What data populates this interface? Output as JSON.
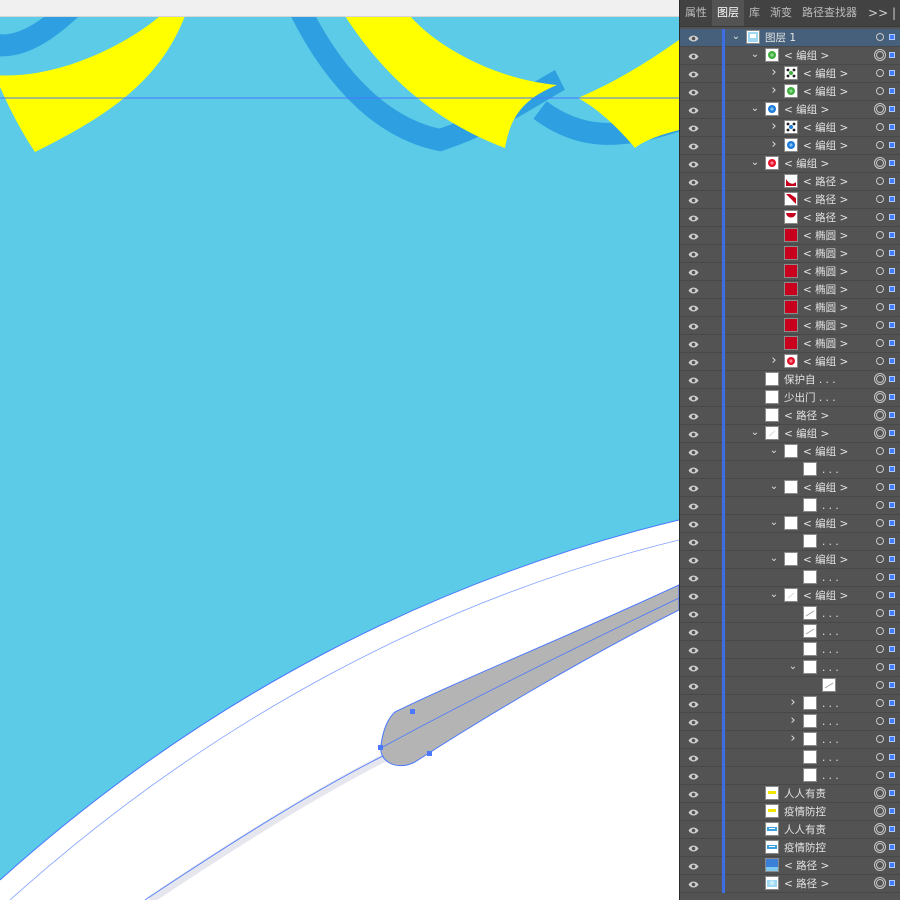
{
  "tabs": [
    {
      "label": "属性"
    },
    {
      "label": "图层"
    },
    {
      "label": "库"
    },
    {
      "label": "渐变"
    },
    {
      "label": "路径查找器"
    }
  ],
  "active_tab": "图层",
  "more_label": ">> |",
  "colors": {
    "canvas_bg": "#5BCBE8",
    "yellow": "#FFFF00",
    "arc_blue": "#2E9FE0",
    "guide_blue": "#4A78FF",
    "grey_shape": "#B4B4B4",
    "panel_bg": "#535353",
    "selected_row": "#46607C",
    "layer_stripe": "#3E6EE6"
  },
  "layers": [
    {
      "label": "图层 1",
      "indent": 0,
      "chevron": "down",
      "thumb": "layer",
      "selected": true,
      "target": "single"
    },
    {
      "label": "< 编组 >",
      "indent": 1,
      "chevron": "down",
      "thumb": "green",
      "target": "double"
    },
    {
      "label": "< 编组 >",
      "indent": 2,
      "chevron": "right",
      "thumb": "green-dots",
      "target": "single"
    },
    {
      "label": "< 编组 >",
      "indent": 2,
      "chevron": "right",
      "thumb": "green",
      "target": "single"
    },
    {
      "label": "< 编组 >",
      "indent": 1,
      "chevron": "down",
      "thumb": "blue",
      "target": "double"
    },
    {
      "label": "< 编组 >",
      "indent": 2,
      "chevron": "right",
      "thumb": "blue-dots",
      "target": "single"
    },
    {
      "label": "< 编组 >",
      "indent": 2,
      "chevron": "right",
      "thumb": "blue",
      "target": "single"
    },
    {
      "label": "< 编组 >",
      "indent": 1,
      "chevron": "down",
      "thumb": "red",
      "target": "double"
    },
    {
      "label": "< 路径 >",
      "indent": 2,
      "chevron": "none",
      "thumb": "red-arc",
      "target": "single"
    },
    {
      "label": "< 路径 >",
      "indent": 2,
      "chevron": "none",
      "thumb": "red-diag",
      "target": "single"
    },
    {
      "label": "< 路径 >",
      "indent": 2,
      "chevron": "none",
      "thumb": "red-bowl",
      "target": "single"
    },
    {
      "label": "< 椭圆 >",
      "indent": 2,
      "chevron": "none",
      "thumb": "red-circle",
      "target": "single"
    },
    {
      "label": "< 椭圆 >",
      "indent": 2,
      "chevron": "none",
      "thumb": "red-circle",
      "target": "single"
    },
    {
      "label": "< 椭圆 >",
      "indent": 2,
      "chevron": "none",
      "thumb": "red-circle",
      "target": "single"
    },
    {
      "label": "< 椭圆 >",
      "indent": 2,
      "chevron": "none",
      "thumb": "red-circle",
      "target": "single"
    },
    {
      "label": "< 椭圆 >",
      "indent": 2,
      "chevron": "none",
      "thumb": "red-circle",
      "target": "single"
    },
    {
      "label": "< 椭圆 >",
      "indent": 2,
      "chevron": "none",
      "thumb": "red-circle",
      "target": "single"
    },
    {
      "label": "< 椭圆 >",
      "indent": 2,
      "chevron": "none",
      "thumb": "red-circle",
      "target": "single"
    },
    {
      "label": "< 编组 >",
      "indent": 2,
      "chevron": "right",
      "thumb": "red",
      "target": "single"
    },
    {
      "label": "保护自 . . .",
      "indent": 1,
      "chevron": "none",
      "thumb": "blank",
      "target": "double"
    },
    {
      "label": "少出门 . . .",
      "indent": 1,
      "chevron": "none",
      "thumb": "blank",
      "target": "double"
    },
    {
      "label": "< 路径 >",
      "indent": 1,
      "chevron": "none",
      "thumb": "blank",
      "target": "double"
    },
    {
      "label": "< 编组 >",
      "indent": 1,
      "chevron": "down",
      "thumb": "faint",
      "target": "double"
    },
    {
      "label": "< 编组 >",
      "indent": 2,
      "chevron": "down",
      "thumb": "blank",
      "target": "single"
    },
    {
      "label": ". . .",
      "indent": 3,
      "chevron": "none",
      "thumb": "blank",
      "target": "single"
    },
    {
      "label": "< 编组 >",
      "indent": 2,
      "chevron": "down",
      "thumb": "blank",
      "target": "single"
    },
    {
      "label": ". . .",
      "indent": 3,
      "chevron": "none",
      "thumb": "blank",
      "target": "single"
    },
    {
      "label": "< 编组 >",
      "indent": 2,
      "chevron": "down",
      "thumb": "blank",
      "target": "single"
    },
    {
      "label": ". . .",
      "indent": 3,
      "chevron": "none",
      "thumb": "blank",
      "target": "single"
    },
    {
      "label": "< 编组 >",
      "indent": 2,
      "chevron": "down",
      "thumb": "blank",
      "target": "single"
    },
    {
      "label": ". . .",
      "indent": 3,
      "chevron": "none",
      "thumb": "blank",
      "target": "single"
    },
    {
      "label": "< 编组 >",
      "indent": 2,
      "chevron": "down",
      "thumb": "faint",
      "target": "single"
    },
    {
      "label": ". . .",
      "indent": 3,
      "chevron": "none",
      "thumb": "line",
      "target": "single"
    },
    {
      "label": ". . .",
      "indent": 3,
      "chevron": "none",
      "thumb": "line",
      "target": "single"
    },
    {
      "label": ". . .",
      "indent": 3,
      "chevron": "none",
      "thumb": "blank",
      "target": "single"
    },
    {
      "label": ". . .",
      "indent": 3,
      "chevron": "down",
      "thumb": "blank",
      "target": "single"
    },
    {
      "label": "",
      "indent": 4,
      "chevron": "none",
      "thumb": "line",
      "target": "single"
    },
    {
      "label": ". . .",
      "indent": 3,
      "chevron": "right",
      "thumb": "blank",
      "target": "single"
    },
    {
      "label": ". . .",
      "indent": 3,
      "chevron": "right",
      "thumb": "blank",
      "target": "single"
    },
    {
      "label": ". . .",
      "indent": 3,
      "chevron": "right",
      "thumb": "blank",
      "target": "single"
    },
    {
      "label": ". . .",
      "indent": 3,
      "chevron": "none",
      "thumb": "blank",
      "target": "single"
    },
    {
      "label": ". . .",
      "indent": 3,
      "chevron": "none",
      "thumb": "blank",
      "target": "single"
    },
    {
      "label": "人人有责",
      "indent": 1,
      "chevron": "none",
      "thumb": "yellow-text",
      "target": "double"
    },
    {
      "label": "疫情防控",
      "indent": 1,
      "chevron": "none",
      "thumb": "yellow-text",
      "target": "double"
    },
    {
      "label": "人人有责",
      "indent": 1,
      "chevron": "none",
      "thumb": "blue-text",
      "target": "double"
    },
    {
      "label": "疫情防控",
      "indent": 1,
      "chevron": "none",
      "thumb": "blue-text",
      "target": "double"
    },
    {
      "label": "< 路径 >",
      "indent": 1,
      "chevron": "none",
      "thumb": "blue-rect",
      "target": "double"
    },
    {
      "label": "< 路径 >",
      "indent": 1,
      "chevron": "none",
      "thumb": "blue-grad",
      "target": "double"
    }
  ]
}
